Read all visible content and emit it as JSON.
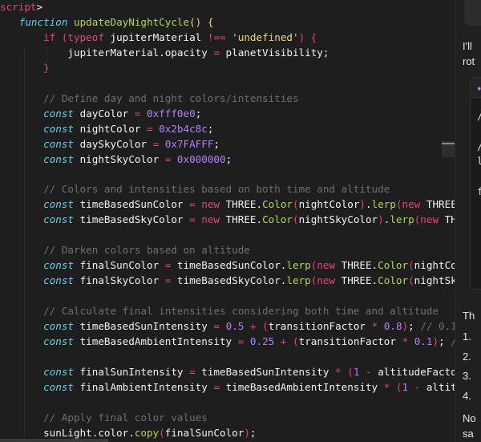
{
  "code": {
    "lines": [
      [
        {
          "c": "tag",
          "t": "script"
        },
        {
          "c": "pl",
          "t": ">"
        }
      ],
      [
        {
          "c": "pl",
          "t": "   "
        },
        {
          "c": "kw",
          "t": "function"
        },
        {
          "c": "pl",
          "t": " "
        },
        {
          "c": "fn",
          "t": "updateDayNightCycle"
        },
        {
          "c": "str",
          "t": "()"
        },
        {
          "c": "pl",
          "t": " "
        },
        {
          "c": "str",
          "t": "{"
        }
      ],
      [
        {
          "c": "pl",
          "t": "       "
        },
        {
          "c": "op",
          "t": "if"
        },
        {
          "c": "pl",
          "t": " "
        },
        {
          "c": "op",
          "t": "(typeof"
        },
        {
          "c": "pl",
          "t": " jupiterMaterial "
        },
        {
          "c": "op",
          "t": "!=="
        },
        {
          "c": "pl",
          "t": " "
        },
        {
          "c": "str",
          "t": "'undefined'"
        },
        {
          "c": "op",
          "t": ")"
        },
        {
          "c": "pl",
          "t": " "
        },
        {
          "c": "op",
          "t": "{"
        }
      ],
      [
        {
          "c": "pl",
          "t": "           jupiterMaterial.opacity "
        },
        {
          "c": "op",
          "t": "="
        },
        {
          "c": "pl",
          "t": " planetVisibility;"
        }
      ],
      [
        {
          "c": "pl",
          "t": "       "
        },
        {
          "c": "op",
          "t": "}"
        }
      ],
      [],
      [
        {
          "c": "pl",
          "t": "       "
        },
        {
          "c": "cm",
          "t": "// Define day and night colors/intensities"
        }
      ],
      [
        {
          "c": "pl",
          "t": "       "
        },
        {
          "c": "kw",
          "t": "const"
        },
        {
          "c": "pl",
          "t": " dayColor "
        },
        {
          "c": "op",
          "t": "="
        },
        {
          "c": "pl",
          "t": " "
        },
        {
          "c": "num",
          "t": "0xfff0e0"
        },
        {
          "c": "pl",
          "t": ";"
        }
      ],
      [
        {
          "c": "pl",
          "t": "       "
        },
        {
          "c": "kw",
          "t": "const"
        },
        {
          "c": "pl",
          "t": " nightColor "
        },
        {
          "c": "op",
          "t": "="
        },
        {
          "c": "pl",
          "t": " "
        },
        {
          "c": "num",
          "t": "0x2b4c8c"
        },
        {
          "c": "pl",
          "t": ";"
        }
      ],
      [
        {
          "c": "pl",
          "t": "       "
        },
        {
          "c": "kw",
          "t": "const"
        },
        {
          "c": "pl",
          "t": " daySkyColor "
        },
        {
          "c": "op",
          "t": "="
        },
        {
          "c": "pl",
          "t": " "
        },
        {
          "c": "num",
          "t": "0x7FAFFF"
        },
        {
          "c": "pl",
          "t": ";"
        }
      ],
      [
        {
          "c": "pl",
          "t": "       "
        },
        {
          "c": "kw",
          "t": "const"
        },
        {
          "c": "pl",
          "t": " nightSkyColor "
        },
        {
          "c": "op",
          "t": "="
        },
        {
          "c": "pl",
          "t": " "
        },
        {
          "c": "num",
          "t": "0x000000"
        },
        {
          "c": "pl",
          "t": ";"
        }
      ],
      [],
      [
        {
          "c": "pl",
          "t": "       "
        },
        {
          "c": "cm",
          "t": "// Colors and intensities based on both time and altitude"
        }
      ],
      [
        {
          "c": "pl",
          "t": "       "
        },
        {
          "c": "kw",
          "t": "const"
        },
        {
          "c": "pl",
          "t": " timeBasedSunColor "
        },
        {
          "c": "op",
          "t": "="
        },
        {
          "c": "pl",
          "t": " "
        },
        {
          "c": "op",
          "t": "new"
        },
        {
          "c": "pl",
          "t": " THREE."
        },
        {
          "c": "fn",
          "t": "Color"
        },
        {
          "c": "op",
          "t": "("
        },
        {
          "c": "pl",
          "t": "nightColor"
        },
        {
          "c": "op",
          "t": ")"
        },
        {
          "c": "pl",
          "t": "."
        },
        {
          "c": "fn",
          "t": "lerp"
        },
        {
          "c": "op",
          "t": "("
        },
        {
          "c": "op",
          "t": "new"
        },
        {
          "c": "pl",
          "t": " THREE"
        }
      ],
      [
        {
          "c": "pl",
          "t": "       "
        },
        {
          "c": "kw",
          "t": "const"
        },
        {
          "c": "pl",
          "t": " timeBasedSkyColor "
        },
        {
          "c": "op",
          "t": "="
        },
        {
          "c": "pl",
          "t": " "
        },
        {
          "c": "op",
          "t": "new"
        },
        {
          "c": "pl",
          "t": " THREE."
        },
        {
          "c": "fn",
          "t": "Color"
        },
        {
          "c": "op",
          "t": "("
        },
        {
          "c": "pl",
          "t": "nightSkyColor"
        },
        {
          "c": "op",
          "t": ")"
        },
        {
          "c": "pl",
          "t": "."
        },
        {
          "c": "fn",
          "t": "lerp"
        },
        {
          "c": "op",
          "t": "("
        },
        {
          "c": "op",
          "t": "new"
        },
        {
          "c": "pl",
          "t": " TH"
        }
      ],
      [],
      [
        {
          "c": "pl",
          "t": "       "
        },
        {
          "c": "cm",
          "t": "// Darken colors based on altitude"
        }
      ],
      [
        {
          "c": "pl",
          "t": "       "
        },
        {
          "c": "kw",
          "t": "const"
        },
        {
          "c": "pl",
          "t": " finalSunColor "
        },
        {
          "c": "op",
          "t": "="
        },
        {
          "c": "pl",
          "t": " timeBasedSunColor."
        },
        {
          "c": "fn",
          "t": "lerp"
        },
        {
          "c": "op",
          "t": "("
        },
        {
          "c": "op",
          "t": "new"
        },
        {
          "c": "pl",
          "t": " THREE."
        },
        {
          "c": "fn",
          "t": "Color"
        },
        {
          "c": "op",
          "t": "("
        },
        {
          "c": "pl",
          "t": "nightCo"
        }
      ],
      [
        {
          "c": "pl",
          "t": "       "
        },
        {
          "c": "kw",
          "t": "const"
        },
        {
          "c": "pl",
          "t": " finalSkyColor "
        },
        {
          "c": "op",
          "t": "="
        },
        {
          "c": "pl",
          "t": " timeBasedSkyColor."
        },
        {
          "c": "fn",
          "t": "lerp"
        },
        {
          "c": "op",
          "t": "("
        },
        {
          "c": "op",
          "t": "new"
        },
        {
          "c": "pl",
          "t": " THREE."
        },
        {
          "c": "fn",
          "t": "Color"
        },
        {
          "c": "op",
          "t": "("
        },
        {
          "c": "pl",
          "t": "nightSk"
        }
      ],
      [],
      [
        {
          "c": "pl",
          "t": "       "
        },
        {
          "c": "cm",
          "t": "// Calculate final intensities considering both time and altitude"
        }
      ],
      [
        {
          "c": "pl",
          "t": "       "
        },
        {
          "c": "kw",
          "t": "const"
        },
        {
          "c": "pl",
          "t": " timeBasedSunIntensity "
        },
        {
          "c": "op",
          "t": "="
        },
        {
          "c": "pl",
          "t": " "
        },
        {
          "c": "num",
          "t": "0.5"
        },
        {
          "c": "pl",
          "t": " "
        },
        {
          "c": "op",
          "t": "+"
        },
        {
          "c": "pl",
          "t": " "
        },
        {
          "c": "op",
          "t": "("
        },
        {
          "c": "pl",
          "t": "transitionFactor "
        },
        {
          "c": "op",
          "t": "*"
        },
        {
          "c": "pl",
          "t": " "
        },
        {
          "c": "num",
          "t": "0.8"
        },
        {
          "c": "op",
          "t": ")"
        },
        {
          "c": "pl",
          "t": "; "
        },
        {
          "c": "cm",
          "t": "// 0.1"
        }
      ],
      [
        {
          "c": "pl",
          "t": "       "
        },
        {
          "c": "kw",
          "t": "const"
        },
        {
          "c": "pl",
          "t": " timeBasedAmbientIntensity "
        },
        {
          "c": "op",
          "t": "="
        },
        {
          "c": "pl",
          "t": " "
        },
        {
          "c": "num",
          "t": "0.25"
        },
        {
          "c": "pl",
          "t": " "
        },
        {
          "c": "op",
          "t": "+"
        },
        {
          "c": "pl",
          "t": " "
        },
        {
          "c": "op",
          "t": "("
        },
        {
          "c": "pl",
          "t": "transitionFactor "
        },
        {
          "c": "op",
          "t": "*"
        },
        {
          "c": "pl",
          "t": " "
        },
        {
          "c": "num",
          "t": "0.1"
        },
        {
          "c": "op",
          "t": ")"
        },
        {
          "c": "pl",
          "t": "; "
        },
        {
          "c": "cm",
          "t": "/"
        }
      ],
      [],
      [
        {
          "c": "pl",
          "t": "       "
        },
        {
          "c": "kw",
          "t": "const"
        },
        {
          "c": "pl",
          "t": " finalSunIntensity "
        },
        {
          "c": "op",
          "t": "="
        },
        {
          "c": "pl",
          "t": " timeBasedSunIntensity "
        },
        {
          "c": "op",
          "t": "*"
        },
        {
          "c": "pl",
          "t": " "
        },
        {
          "c": "op",
          "t": "("
        },
        {
          "c": "num",
          "t": "1"
        },
        {
          "c": "pl",
          "t": " "
        },
        {
          "c": "op",
          "t": "-"
        },
        {
          "c": "pl",
          "t": " altitudeFacto"
        }
      ],
      [
        {
          "c": "pl",
          "t": "       "
        },
        {
          "c": "kw",
          "t": "const"
        },
        {
          "c": "pl",
          "t": " finalAmbientIntensity "
        },
        {
          "c": "op",
          "t": "="
        },
        {
          "c": "pl",
          "t": " timeBasedAmbientIntensity "
        },
        {
          "c": "op",
          "t": "*"
        },
        {
          "c": "pl",
          "t": " "
        },
        {
          "c": "op",
          "t": "("
        },
        {
          "c": "num",
          "t": "1"
        },
        {
          "c": "pl",
          "t": " "
        },
        {
          "c": "op",
          "t": "-"
        },
        {
          "c": "pl",
          "t": " altit"
        }
      ],
      [],
      [
        {
          "c": "pl",
          "t": "       "
        },
        {
          "c": "cm",
          "t": "// Apply final color values"
        }
      ],
      [
        {
          "c": "pl",
          "t": "       sunLight.color."
        },
        {
          "c": "fn",
          "t": "copy"
        },
        {
          "c": "op",
          "t": "("
        },
        {
          "c": "pl",
          "t": "finalSunColor"
        },
        {
          "c": "op",
          "t": ")"
        },
        {
          "c": "pl",
          "t": ";"
        }
      ]
    ]
  },
  "chat": {
    "intro_lines": [
      "I'll",
      "rot"
    ],
    "code_block_lines": [
      "/",
      "/",
      "l",
      "f"
    ],
    "after_text": "Th",
    "list_items": [
      "1.",
      "2.",
      "3.",
      "4."
    ],
    "note_lines": [
      "No",
      "sa"
    ]
  }
}
